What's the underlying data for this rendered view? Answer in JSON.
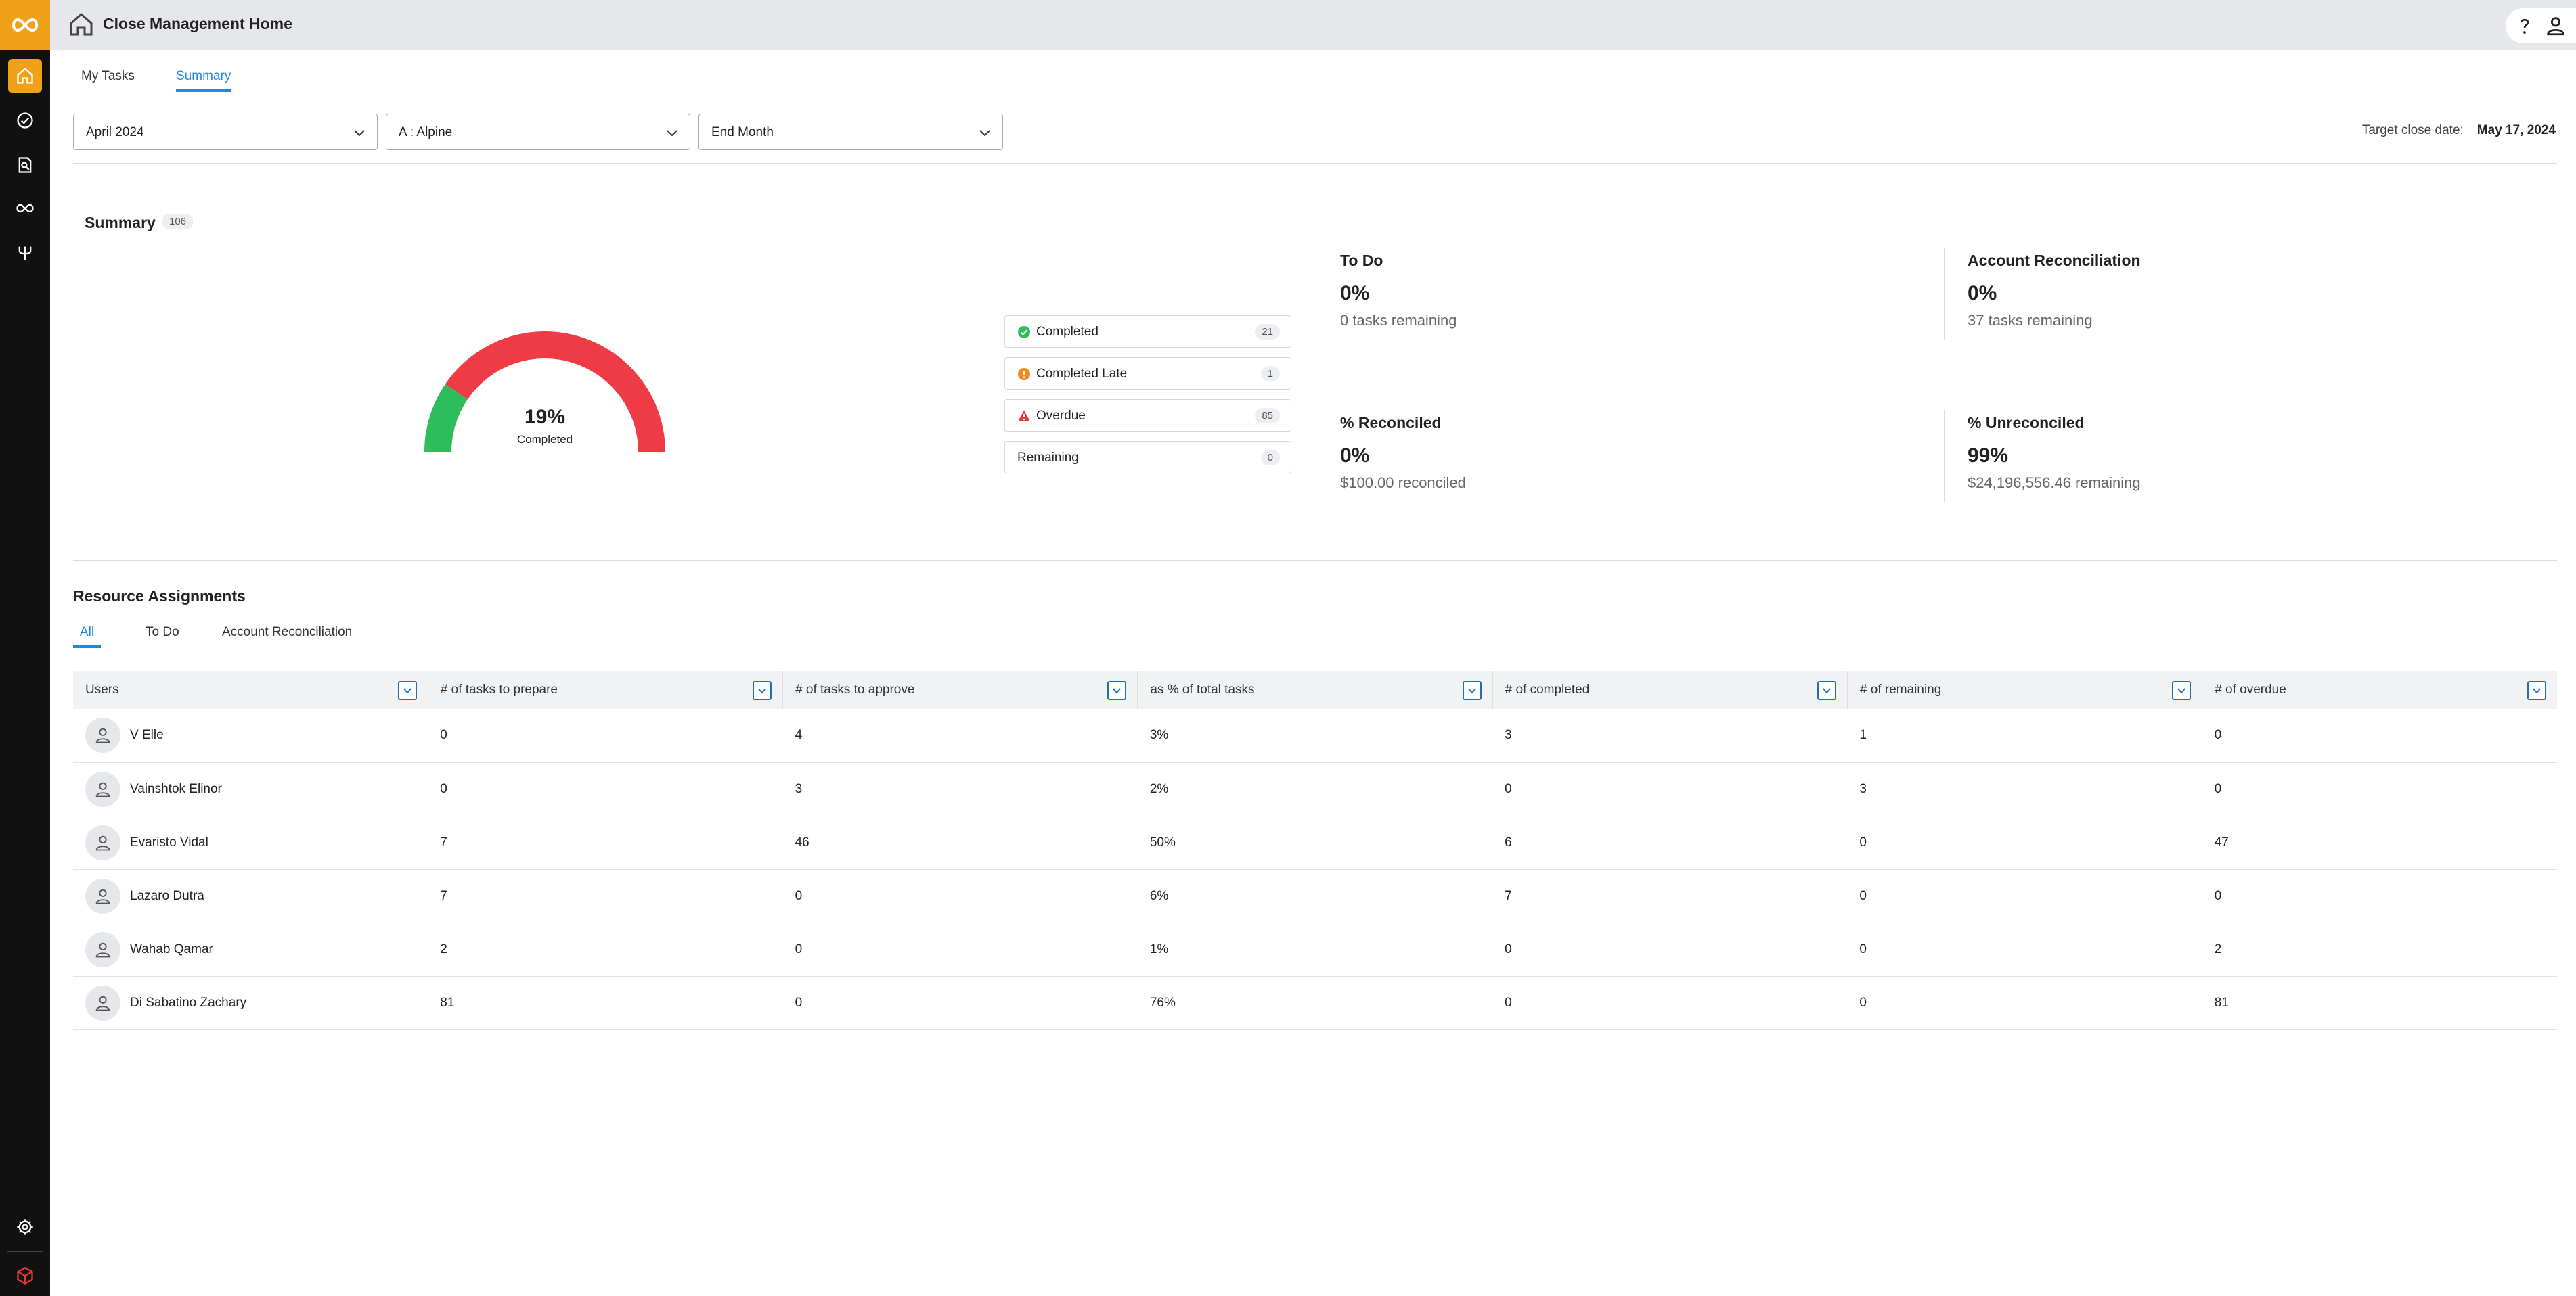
{
  "app": {
    "title": "Close Management Home",
    "brand_color": "#f0a11a",
    "accent_color": "#1e88e5"
  },
  "nav": {
    "items": [
      {
        "icon": "home-icon",
        "active": true
      },
      {
        "icon": "check-circle-icon",
        "active": false
      },
      {
        "icon": "search-document-icon",
        "active": false
      },
      {
        "icon": "infinity-icon",
        "active": false
      },
      {
        "icon": "fork-icon",
        "active": false
      }
    ],
    "bottom": [
      {
        "icon": "gear-icon"
      },
      {
        "icon": "cube-icon"
      }
    ]
  },
  "header": {
    "help_icon": "help-icon",
    "user_icon": "user-icon"
  },
  "page_tabs": [
    {
      "label": "My Tasks",
      "active": false
    },
    {
      "label": "Summary",
      "active": true
    }
  ],
  "filters": {
    "period": "April 2024",
    "entity": "A : Alpine",
    "schedule": "End Month",
    "target_label": "Target close date:",
    "target_value": "May 17, 2024"
  },
  "summary": {
    "title": "Summary",
    "count": "106",
    "gauge": {
      "percent_label": "19%",
      "caption": "Completed",
      "completed_fraction": 0.19,
      "completed_color": "#2dbd5b",
      "remaining_color": "#ef3b45"
    },
    "legend": [
      {
        "label": "Completed",
        "count": "21",
        "icon": "check-circle-icon",
        "color": "#2dbd5b"
      },
      {
        "label": "Completed Late",
        "count": "1",
        "icon": "warning-circle-icon",
        "color": "#f08a1c"
      },
      {
        "label": "Overdue",
        "count": "85",
        "icon": "warning-triangle-icon",
        "color": "#e53935"
      },
      {
        "label": "Remaining",
        "count": "0",
        "icon": "",
        "color": ""
      }
    ],
    "stats": [
      {
        "heading": "To Do",
        "percent": "0%",
        "sub": "0 tasks remaining"
      },
      {
        "heading": "Account Reconciliation",
        "percent": "0%",
        "sub": "37 tasks remaining"
      },
      {
        "heading": "% Reconciled",
        "percent": "0%",
        "sub": "$100.00 reconciled"
      },
      {
        "heading": "% Unreconciled",
        "percent": "99%",
        "sub": "$24,196,556.46 remaining"
      }
    ]
  },
  "resource_assignments": {
    "title": "Resource Assignments",
    "tabs": [
      {
        "label": "All",
        "active": true
      },
      {
        "label": "To Do",
        "active": false
      },
      {
        "label": "Account Reconciliation",
        "active": false
      }
    ],
    "columns": [
      "Users",
      "# of tasks to prepare",
      "# of tasks to approve",
      "as % of total tasks",
      "# of completed",
      "# of remaining",
      "# of overdue"
    ],
    "rows": [
      [
        "V Elle",
        "0",
        "4",
        "3%",
        "3",
        "1",
        "0"
      ],
      [
        "Vainshtok Elinor",
        "0",
        "3",
        "2%",
        "0",
        "3",
        "0"
      ],
      [
        "Evaristo Vidal",
        "7",
        "46",
        "50%",
        "6",
        "0",
        "47"
      ],
      [
        "Lazaro Dutra",
        "7",
        "0",
        "6%",
        "7",
        "0",
        "0"
      ],
      [
        "Wahab Qamar",
        "2",
        "0",
        "1%",
        "0",
        "0",
        "2"
      ],
      [
        "Di Sabatino Zachary",
        "81",
        "0",
        "76%",
        "0",
        "0",
        "81"
      ]
    ]
  }
}
